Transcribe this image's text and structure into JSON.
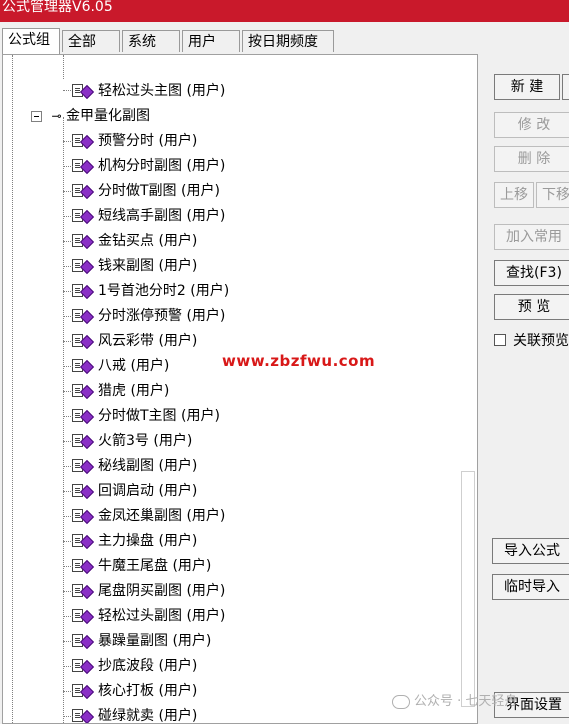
{
  "window": {
    "title": "公式管理器V6.05",
    "title_color": "#c9192b"
  },
  "tabs": [
    {
      "label": "公式组",
      "active": true
    },
    {
      "label": "全部"
    },
    {
      "label": "系统"
    },
    {
      "label": "用户"
    },
    {
      "label": "按日期频度"
    }
  ],
  "tree": {
    "top_item": "轻松过头主图 (用户)",
    "group": "金甲量化副图",
    "items": [
      "预警分时 (用户)",
      "机构分时副图 (用户)",
      "分时做T副图 (用户)",
      "短线高手副图 (用户)",
      "金钻买点 (用户)",
      "钱来副图 (用户)",
      "1号首池分时2 (用户)",
      "分时涨停预警 (用户)",
      "风云彩带 (用户)",
      "八戒 (用户)",
      "猎虎 (用户)",
      "分时做T主图 (用户)",
      "火箭3号 (用户)",
      "秘线副图 (用户)",
      "回调启动 (用户)",
      "金凤还巢副图 (用户)",
      "主力操盘 (用户)",
      "牛魔王尾盘 (用户)",
      "尾盘阴买副图 (用户)",
      "轻松过头副图 (用户)",
      "暴躁量副图 (用户)",
      "抄底波段 (用户)",
      "核心打板 (用户)",
      "碰绿就卖 (用户)"
    ]
  },
  "buttons": {
    "new": "新 建",
    "edit": "修 改",
    "delete": "删 除",
    "move_up": "上移",
    "move_down": "下移",
    "add_common": "加入常用",
    "find": "查找(F3)",
    "preview": "预 览",
    "import": "导入公式",
    "temp_import": "临时导入",
    "ui_settings": "界面设置"
  },
  "linked_preview": {
    "label": "关联预览",
    "checked": false
  },
  "watermark": "www.zbzfwu.com",
  "wechat_watermark": "公众号 · 七天轻舟"
}
